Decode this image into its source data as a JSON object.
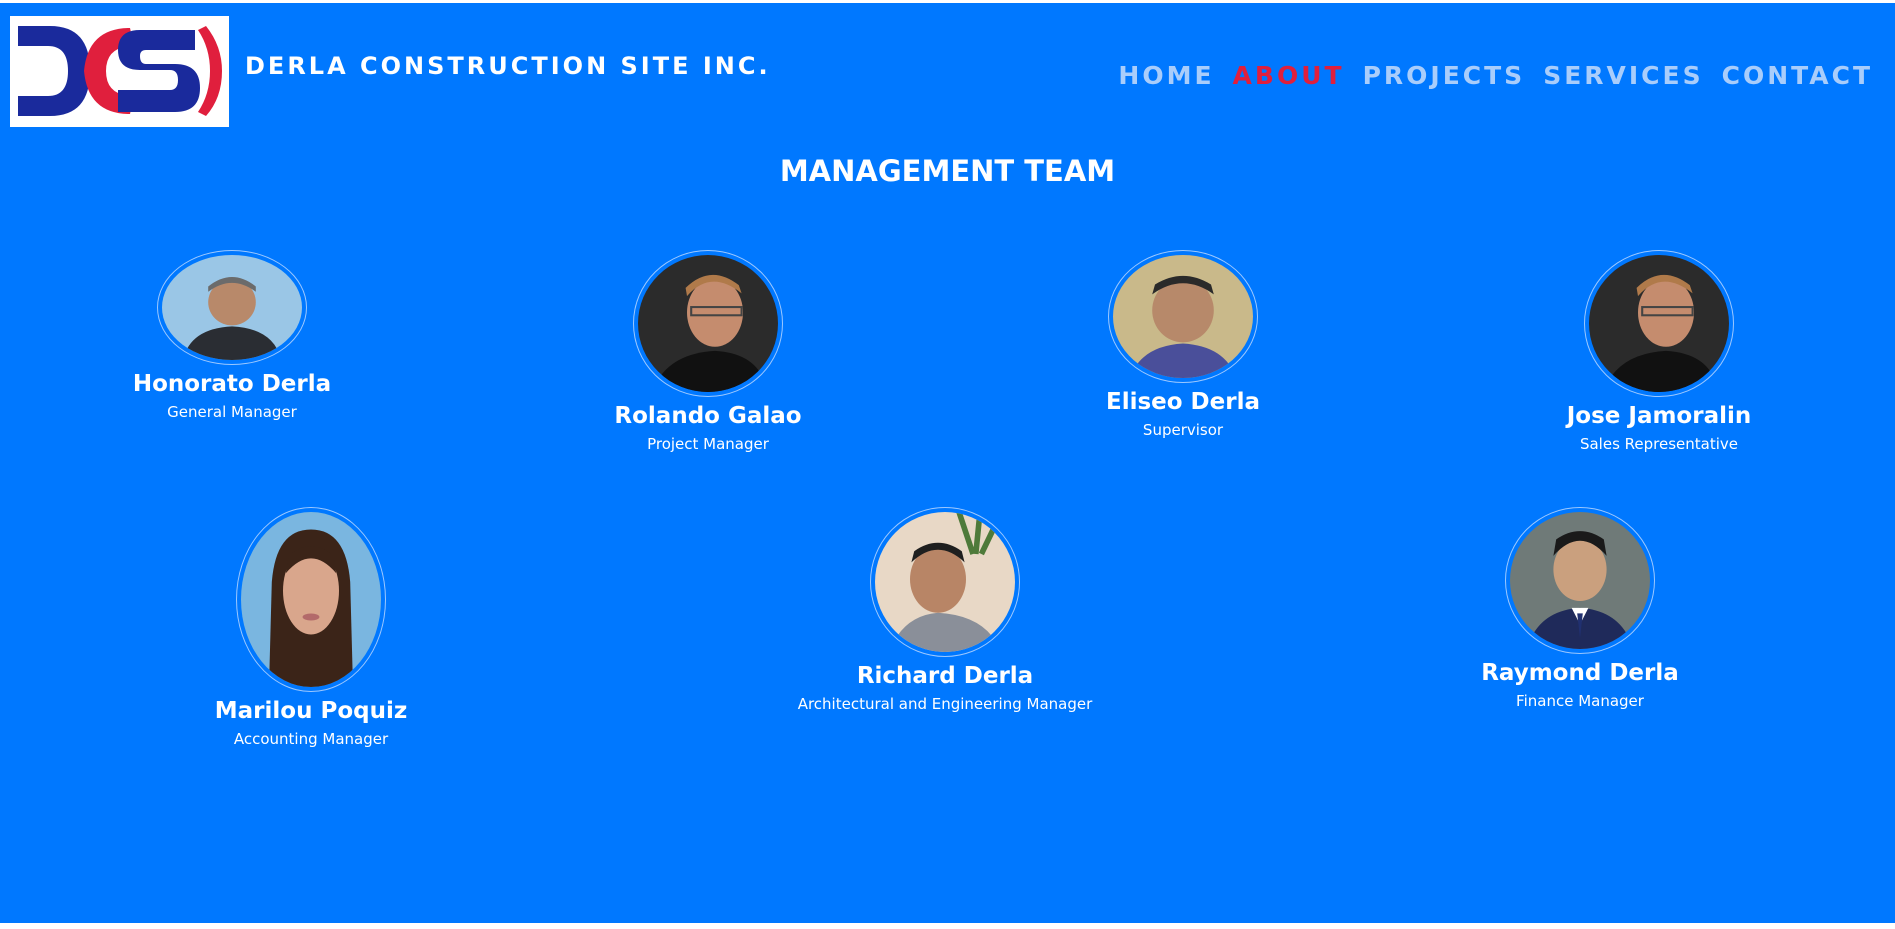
{
  "header": {
    "brand": "DERLA CONSTRUCTION SITE INC.",
    "logo_text": "DCSI"
  },
  "nav": {
    "items": [
      {
        "label": "HOME",
        "active": false
      },
      {
        "label": "ABOUT",
        "active": true
      },
      {
        "label": "PROJECTS",
        "active": false
      },
      {
        "label": "SERVICES",
        "active": false
      },
      {
        "label": "CONTACT",
        "active": false
      }
    ]
  },
  "section": {
    "title": "MANAGEMENT TEAM"
  },
  "team": [
    {
      "name": "Honorato Derla",
      "role": "General Manager"
    },
    {
      "name": "Rolando Galao",
      "role": "Project Manager"
    },
    {
      "name": "Eliseo Derla",
      "role": "Supervisor"
    },
    {
      "name": "Jose Jamoralin",
      "role": "Sales Representative"
    },
    {
      "name": "Marilou Poquiz",
      "role": "Accounting Manager"
    },
    {
      "name": "Richard Derla",
      "role": "Architectural and Engineering Manager"
    },
    {
      "name": "Raymond Derla",
      "role": "Finance Manager"
    }
  ],
  "colors": {
    "page_background": "#0078ff",
    "nav_inactive": "#a9cdfb",
    "nav_active": "#e01f3d",
    "logo_blue": "#1a2a9c",
    "logo_red": "#e01f3d"
  }
}
